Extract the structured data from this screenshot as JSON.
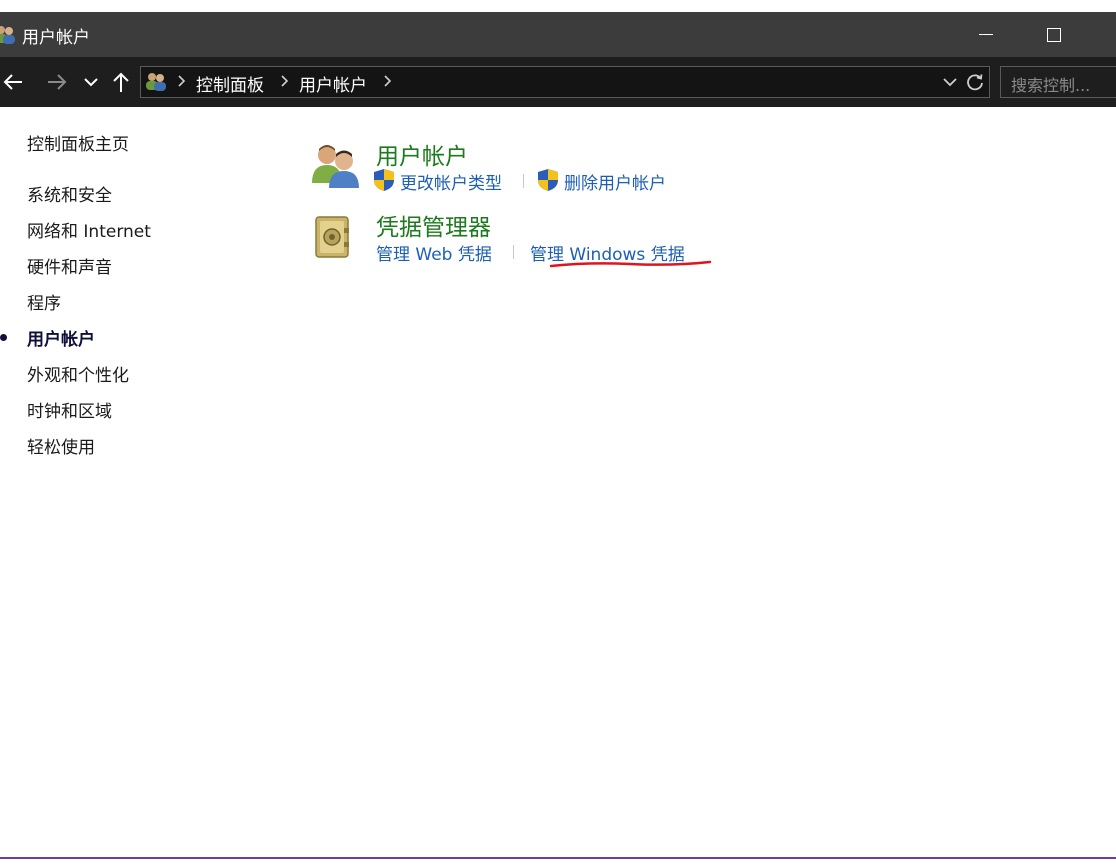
{
  "window": {
    "title": "用户帐户"
  },
  "addressbar": {
    "crumbs": [
      "控制面板",
      "用户帐户"
    ]
  },
  "search": {
    "placeholder": "搜索控制..."
  },
  "sidebar": {
    "home": "控制面板主页",
    "items": [
      {
        "label": "系统和安全"
      },
      {
        "label": "网络和 Internet"
      },
      {
        "label": "硬件和声音"
      },
      {
        "label": "程序"
      },
      {
        "label": "用户帐户",
        "active": true
      },
      {
        "label": "外观和个性化"
      },
      {
        "label": "时钟和区域"
      },
      {
        "label": "轻松使用"
      }
    ]
  },
  "main": {
    "sections": [
      {
        "title": "用户帐户",
        "icon": "users-icon",
        "links": [
          "更改帐户类型",
          "删除用户帐户"
        ]
      },
      {
        "title": "凭据管理器",
        "icon": "vault-icon",
        "links": [
          "管理 Web 凭据",
          "管理 Windows 凭据"
        ]
      }
    ]
  },
  "colors": {
    "section_title": "#1e7a1e",
    "link": "#1c5fb5",
    "annotation": "#e0141e"
  }
}
